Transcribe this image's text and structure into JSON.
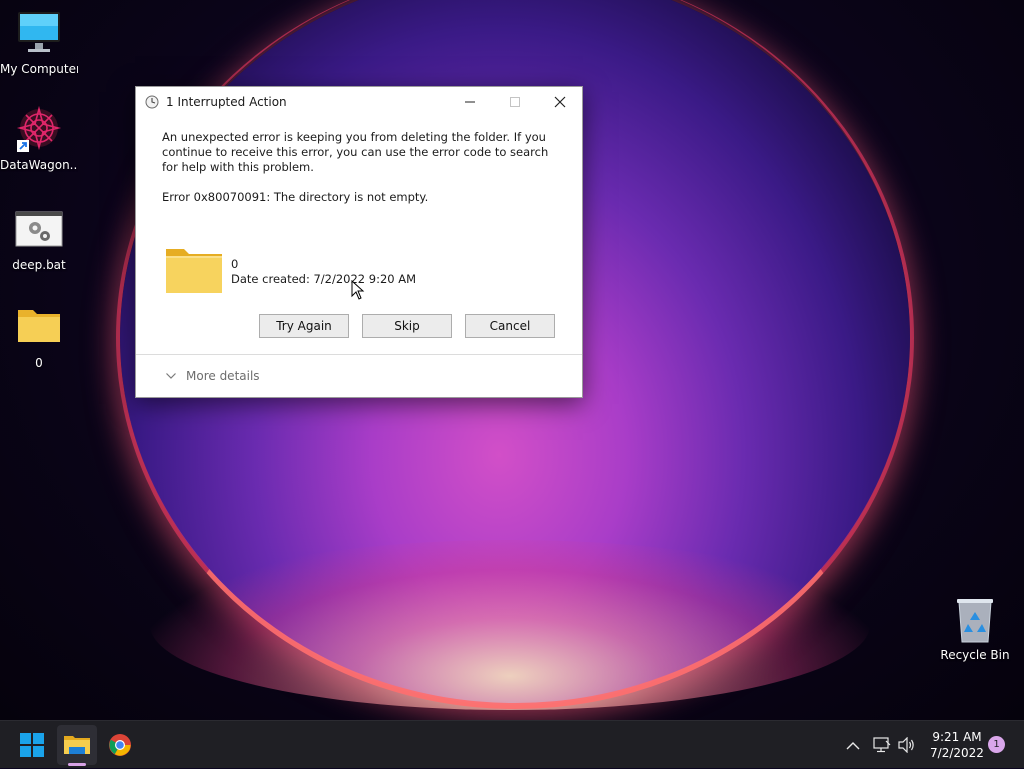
{
  "desktop": {
    "icons": [
      {
        "label": "My Computer",
        "icon": "monitor-icon"
      },
      {
        "label": "DataWagon...",
        "icon": "datawagon-icon"
      },
      {
        "label": "deep.bat",
        "icon": "batch-file-icon"
      },
      {
        "label": "0",
        "icon": "folder-icon"
      },
      {
        "label": "Recycle Bin",
        "icon": "recycle-bin-icon"
      }
    ]
  },
  "dialog": {
    "title": "1 Interrupted Action",
    "message": "An unexpected error is keeping you from deleting the folder. If you continue to receive this error, you can use the error code to search for help with this problem.",
    "error_line": "Error 0x80070091: The directory is not empty.",
    "item_name": "0",
    "item_date": "Date created: 7/2/2022 9:20 AM",
    "buttons": {
      "try_again": "Try Again",
      "skip": "Skip",
      "cancel": "Cancel"
    },
    "more_details": "More details"
  },
  "taskbar": {
    "apps": [
      "start",
      "file-explorer",
      "chrome"
    ],
    "clock": {
      "time": "9:21 AM",
      "date": "7/2/2022"
    },
    "notification_count": "1"
  },
  "colors": {
    "folder_yellow": "#f6c844",
    "taskbar_bg": "#1f1f24",
    "accent_pink": "#d9a6ea",
    "start_blue": "#1aa3ea"
  }
}
